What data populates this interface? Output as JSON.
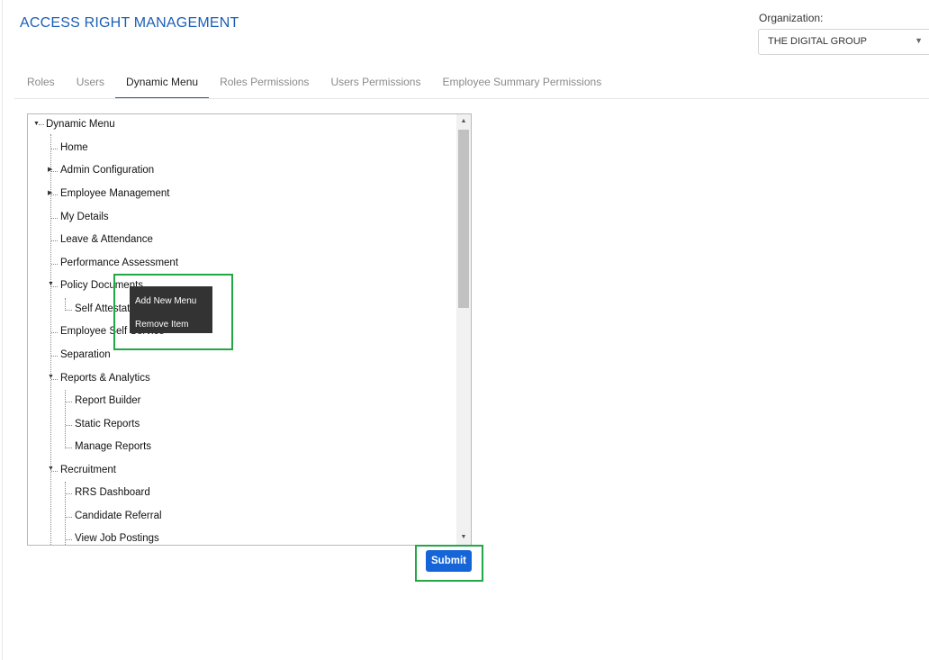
{
  "header": {
    "title": "ACCESS RIGHT MANAGEMENT",
    "organization_label": "Organization:",
    "organization_value": "THE DIGITAL GROUP"
  },
  "tabs": [
    {
      "label": "Roles",
      "active": false
    },
    {
      "label": "Users",
      "active": false
    },
    {
      "label": "Dynamic Menu",
      "active": true
    },
    {
      "label": "Roles Permissions",
      "active": false
    },
    {
      "label": "Users Permissions",
      "active": false
    },
    {
      "label": "Employee Summary Permissions",
      "active": false
    }
  ],
  "tree": {
    "root": "Dynamic Menu",
    "items": [
      "Home",
      "Admin Configuration",
      "Employee Management",
      "My Details",
      "Leave & Attendance",
      "Performance Assessment",
      "Policy Documents",
      "Self Attestation",
      "Employee Self Service",
      "Separation",
      "Reports & Analytics",
      "Report Builder",
      "Static Reports",
      "Manage Reports",
      "Recruitment",
      "RRS Dashboard",
      "Candidate Referral",
      "View Job Postings"
    ]
  },
  "context_menu": {
    "add_label": "Add New Menu",
    "remove_label": "Remove Item"
  },
  "submit_label": "Submit",
  "colors": {
    "accent": "#1a5fb4",
    "button": "#1565d8",
    "highlight": "#22a745",
    "context_menu_bg": "#333333"
  }
}
